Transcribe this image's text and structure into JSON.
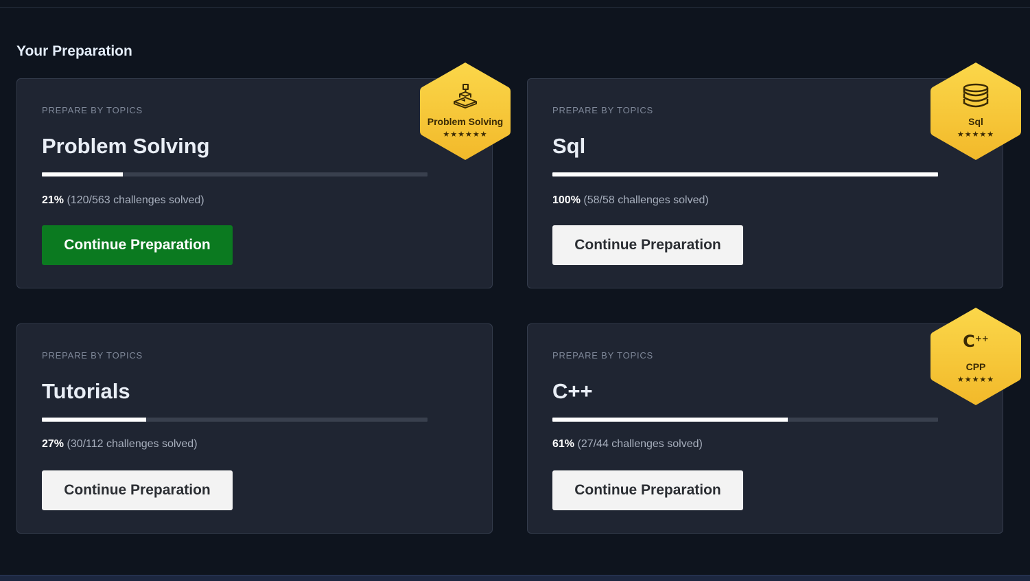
{
  "section": {
    "title": "Your Preparation"
  },
  "cards": [
    {
      "eyebrow": "PREPARE BY TOPICS",
      "title": "Problem Solving",
      "percent_label": "21%",
      "progress_fraction": 0.21,
      "solved_label": "(120/563 challenges solved)",
      "button_label": "Continue Preparation",
      "button_style": "primary",
      "badge": {
        "label": "Problem Solving",
        "icon": "puzzle-blocks-icon",
        "stars": "★★★★★★",
        "star_count": 6
      }
    },
    {
      "eyebrow": "PREPARE BY TOPICS",
      "title": "Sql",
      "percent_label": "100%",
      "progress_fraction": 1.0,
      "solved_label": "(58/58 challenges solved)",
      "button_label": "Continue Preparation",
      "button_style": "secondary",
      "badge": {
        "label": "Sql",
        "icon": "database-icon",
        "stars": "★★★★★",
        "star_count": 5
      }
    },
    {
      "eyebrow": "PREPARE BY TOPICS",
      "title": "Tutorials",
      "percent_label": "27%",
      "progress_fraction": 0.27,
      "solved_label": "(30/112 challenges solved)",
      "button_label": "Continue Preparation",
      "button_style": "secondary",
      "badge": null
    },
    {
      "eyebrow": "PREPARE BY TOPICS",
      "title": "C++",
      "percent_label": "61%",
      "progress_fraction": 0.61,
      "solved_label": "(27/44 challenges solved)",
      "button_label": "Continue Preparation",
      "button_style": "secondary",
      "badge": {
        "label": "CPP",
        "icon": "cpp-logo-icon",
        "icon_text": "C",
        "icon_sup": "++",
        "stars": "★★★★★",
        "star_count": 5
      }
    }
  ],
  "colors": {
    "page_background": "#0e141e",
    "card_background": "#1f2532",
    "primary_button": "#0b7a20",
    "secondary_button": "#f3f3f3",
    "badge_gold": "#f5c233",
    "progress_fill": "#ffffff",
    "progress_track": "#39404e"
  }
}
